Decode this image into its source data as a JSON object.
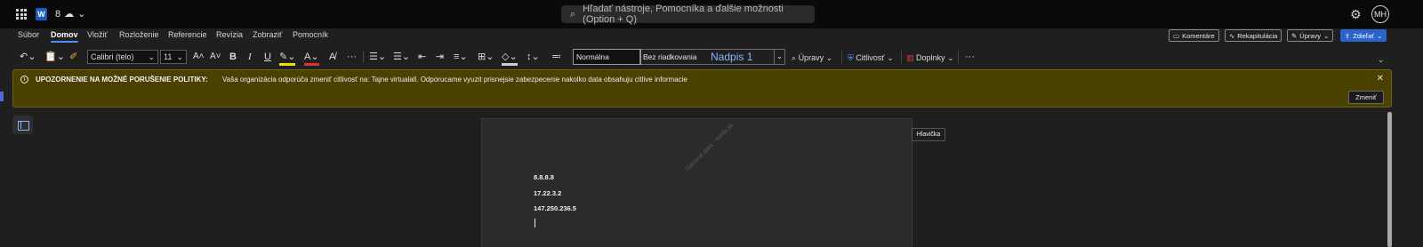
{
  "titlebar": {
    "doc_name": "8",
    "search_placeholder": "Hľadať nástroje, Pomocníka a ďalšie možnosti (Option + Q)",
    "avatar_initials": "MH"
  },
  "tabs": [
    "Súbor",
    "Domov",
    "Vložiť",
    "Rozloženie",
    "Referencie",
    "Revízia",
    "Zobraziť",
    "Pomocník"
  ],
  "top_buttons": {
    "comments": "Komentáre",
    "recap": "Rekapitulácia",
    "editing": "Úpravy",
    "share": "Zdieľať"
  },
  "toolbar": {
    "font_name": "Calibri (telo)",
    "font_size": "11",
    "style_normal": "Normálna",
    "style_no_spacing": "Bez riadkovania",
    "style_heading1": "Nadpis 1",
    "find_label": "Úpravy",
    "sensitivity_label": "Citlivosť",
    "addins_label": "Doplnky"
  },
  "banner": {
    "title": "UPOZORNENIE NA MOŽNÉ PORUŠENIE POLITIKY:",
    "message": "Vaša organizácia odporúča zmeniť citlivosť na: Tajne virtualall. Odporucame vyuzit prisnejsie zabezpecenie nakolko data obsahuju citlive informacie",
    "button": "Zmeniť"
  },
  "document": {
    "watermark": "General data - minfo.sk",
    "lines": [
      "8.8.8.8",
      "17.22.3.2",
      "147.250.236.5"
    ],
    "header_tooltip": "Hlavička"
  },
  "colors": {
    "banner_bg": "#4a4000",
    "accent": "#2a63c9",
    "heading_style": "#8cb4ff"
  }
}
